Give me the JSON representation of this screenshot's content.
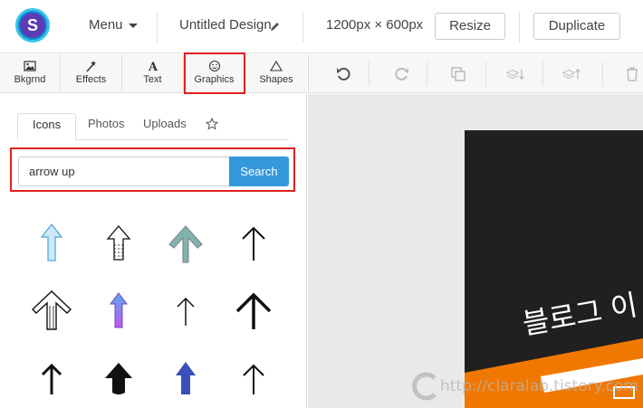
{
  "header": {
    "logo_letter": "S",
    "menu_label": "Menu",
    "design_title": "Untitled Design",
    "canvas_size": "1200px × 600px",
    "resize_label": "Resize",
    "duplicate_label": "Duplicate"
  },
  "tools": [
    {
      "label": "Bkgrnd",
      "icon": "image-icon"
    },
    {
      "label": "Effects",
      "icon": "magic-wand-icon"
    },
    {
      "label": "Text",
      "icon": "text-icon"
    },
    {
      "label": "Graphics",
      "icon": "smiley-icon",
      "highlighted": true
    },
    {
      "label": "Shapes",
      "icon": "triangle-icon"
    }
  ],
  "canvas_tools": [
    "undo-icon",
    "redo-icon",
    "copy-icon",
    "layer-down-icon",
    "layer-up-icon",
    "trash-icon"
  ],
  "panel": {
    "tabs": [
      "Icons",
      "Photos",
      "Uploads"
    ],
    "active_tab": "Icons",
    "search_value": "arrow up",
    "search_button": "Search"
  },
  "icon_results": [
    "arrow-up-light-blue-icon",
    "arrow-up-dashed-outline-icon",
    "arrow-up-teal-chevron-icon",
    "arrow-up-thin-icon",
    "arrow-up-striped-outline-icon",
    "arrow-up-gradient-icon",
    "arrow-up-thin-small-icon",
    "arrow-up-bold-chevron-icon",
    "arrow-up-black-icon",
    "arrow-up-bold-black-icon",
    "arrow-up-blue-icon",
    "arrow-up-thin-dark-icon"
  ],
  "canvas": {
    "text": "블로그 이",
    "watermark": "http://claralab.tistory.com"
  },
  "colors": {
    "accent": "#3498db",
    "highlight": "#e02020",
    "canvas_bg": "#202020",
    "canvas_orange": "#f07800"
  }
}
